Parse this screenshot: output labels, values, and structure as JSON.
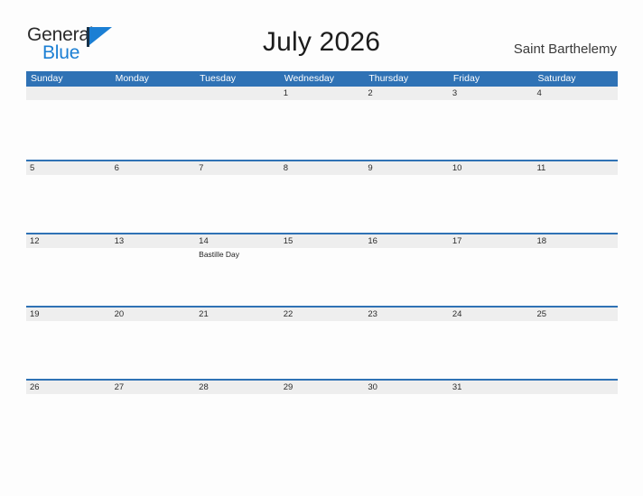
{
  "brand": {
    "name_part1": "General",
    "name_part2": "Blue",
    "flag_icon": "flag-icon"
  },
  "header": {
    "title": "July 2026",
    "region": "Saint Barthelemy"
  },
  "colors": {
    "header_blue": "#2f72b5",
    "row_divider_blue": "#2f72b5",
    "daynum_band": "#eeeeee",
    "brand_blue": "#1b7fd4",
    "page_background": "#fdfdfd"
  },
  "calendar": {
    "month": "July",
    "year": "2026",
    "weekday_headers": [
      "Sunday",
      "Monday",
      "Tuesday",
      "Wednesday",
      "Thursday",
      "Friday",
      "Saturday"
    ],
    "weeks": [
      {
        "days": [
          {
            "num": "",
            "events": []
          },
          {
            "num": "",
            "events": []
          },
          {
            "num": "",
            "events": []
          },
          {
            "num": "1",
            "events": []
          },
          {
            "num": "2",
            "events": []
          },
          {
            "num": "3",
            "events": []
          },
          {
            "num": "4",
            "events": []
          }
        ]
      },
      {
        "days": [
          {
            "num": "5",
            "events": []
          },
          {
            "num": "6",
            "events": []
          },
          {
            "num": "7",
            "events": []
          },
          {
            "num": "8",
            "events": []
          },
          {
            "num": "9",
            "events": []
          },
          {
            "num": "10",
            "events": []
          },
          {
            "num": "11",
            "events": []
          }
        ]
      },
      {
        "days": [
          {
            "num": "12",
            "events": []
          },
          {
            "num": "13",
            "events": []
          },
          {
            "num": "14",
            "events": [
              "Bastille Day"
            ]
          },
          {
            "num": "15",
            "events": []
          },
          {
            "num": "16",
            "events": []
          },
          {
            "num": "17",
            "events": []
          },
          {
            "num": "18",
            "events": []
          }
        ]
      },
      {
        "days": [
          {
            "num": "19",
            "events": []
          },
          {
            "num": "20",
            "events": []
          },
          {
            "num": "21",
            "events": []
          },
          {
            "num": "22",
            "events": []
          },
          {
            "num": "23",
            "events": []
          },
          {
            "num": "24",
            "events": []
          },
          {
            "num": "25",
            "events": []
          }
        ]
      },
      {
        "days": [
          {
            "num": "26",
            "events": []
          },
          {
            "num": "27",
            "events": []
          },
          {
            "num": "28",
            "events": []
          },
          {
            "num": "29",
            "events": []
          },
          {
            "num": "30",
            "events": []
          },
          {
            "num": "31",
            "events": []
          },
          {
            "num": "",
            "events": []
          }
        ]
      }
    ]
  }
}
